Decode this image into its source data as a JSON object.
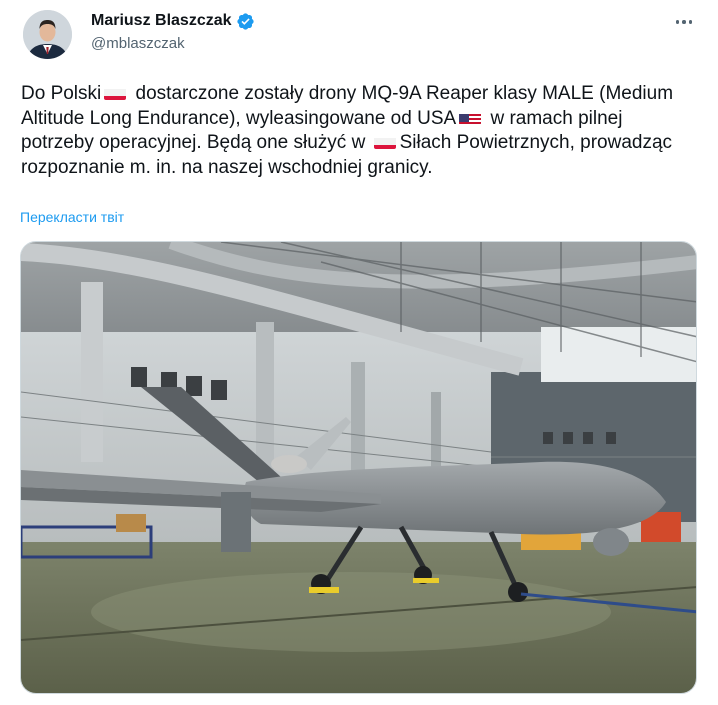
{
  "author": {
    "name": "Mariusz Blaszczak",
    "handle": "@mblaszczak",
    "verified": true
  },
  "icons": {
    "verified": "verified-badge-icon",
    "more": "more-dots-icon",
    "flag_pl": "poland-flag-emoji",
    "flag_us": "usa-flag-emoji"
  },
  "tweet": {
    "seg1": "Do Polski",
    "seg2": " dostarczone zostały drony MQ-9A Reaper klasy MALE (Medium Altitude Long Endurance), wyleasingowane od USA",
    "seg3": " w ramach pilnej potrzeby operacyjnej. Będą one służyć w ",
    "seg4": "Siłach Powietrznych, prowadząc rozpoznanie m. in. na naszej wschodniej granicy."
  },
  "translate_label": "Перекласти твіт",
  "colors": {
    "link": "#1d9bf0",
    "secondary_text": "#536471",
    "verified": "#1d9bf0"
  }
}
